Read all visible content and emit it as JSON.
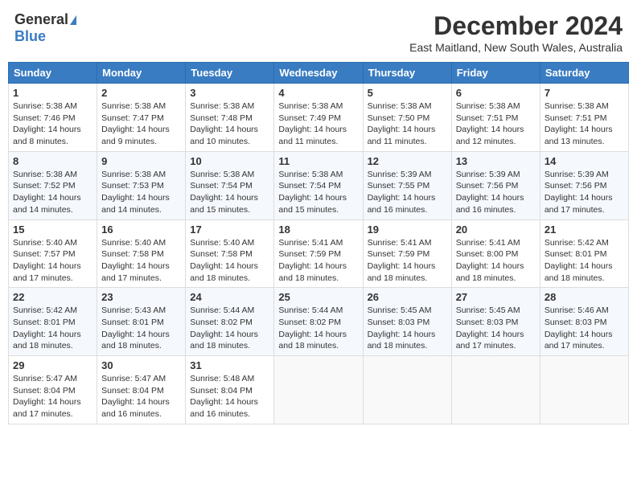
{
  "header": {
    "logo_general": "General",
    "logo_blue": "Blue",
    "month_title": "December 2024",
    "location": "East Maitland, New South Wales, Australia"
  },
  "days_of_week": [
    "Sunday",
    "Monday",
    "Tuesday",
    "Wednesday",
    "Thursday",
    "Friday",
    "Saturday"
  ],
  "weeks": [
    [
      {
        "day": "1",
        "sunrise": "5:38 AM",
        "sunset": "7:46 PM",
        "daylight": "14 hours and 8 minutes."
      },
      {
        "day": "2",
        "sunrise": "5:38 AM",
        "sunset": "7:47 PM",
        "daylight": "14 hours and 9 minutes."
      },
      {
        "day": "3",
        "sunrise": "5:38 AM",
        "sunset": "7:48 PM",
        "daylight": "14 hours and 10 minutes."
      },
      {
        "day": "4",
        "sunrise": "5:38 AM",
        "sunset": "7:49 PM",
        "daylight": "14 hours and 11 minutes."
      },
      {
        "day": "5",
        "sunrise": "5:38 AM",
        "sunset": "7:50 PM",
        "daylight": "14 hours and 11 minutes."
      },
      {
        "day": "6",
        "sunrise": "5:38 AM",
        "sunset": "7:51 PM",
        "daylight": "14 hours and 12 minutes."
      },
      {
        "day": "7",
        "sunrise": "5:38 AM",
        "sunset": "7:51 PM",
        "daylight": "14 hours and 13 minutes."
      }
    ],
    [
      {
        "day": "8",
        "sunrise": "5:38 AM",
        "sunset": "7:52 PM",
        "daylight": "14 hours and 14 minutes."
      },
      {
        "day": "9",
        "sunrise": "5:38 AM",
        "sunset": "7:53 PM",
        "daylight": "14 hours and 14 minutes."
      },
      {
        "day": "10",
        "sunrise": "5:38 AM",
        "sunset": "7:54 PM",
        "daylight": "14 hours and 15 minutes."
      },
      {
        "day": "11",
        "sunrise": "5:38 AM",
        "sunset": "7:54 PM",
        "daylight": "14 hours and 15 minutes."
      },
      {
        "day": "12",
        "sunrise": "5:39 AM",
        "sunset": "7:55 PM",
        "daylight": "14 hours and 16 minutes."
      },
      {
        "day": "13",
        "sunrise": "5:39 AM",
        "sunset": "7:56 PM",
        "daylight": "14 hours and 16 minutes."
      },
      {
        "day": "14",
        "sunrise": "5:39 AM",
        "sunset": "7:56 PM",
        "daylight": "14 hours and 17 minutes."
      }
    ],
    [
      {
        "day": "15",
        "sunrise": "5:40 AM",
        "sunset": "7:57 PM",
        "daylight": "14 hours and 17 minutes."
      },
      {
        "day": "16",
        "sunrise": "5:40 AM",
        "sunset": "7:58 PM",
        "daylight": "14 hours and 17 minutes."
      },
      {
        "day": "17",
        "sunrise": "5:40 AM",
        "sunset": "7:58 PM",
        "daylight": "14 hours and 18 minutes."
      },
      {
        "day": "18",
        "sunrise": "5:41 AM",
        "sunset": "7:59 PM",
        "daylight": "14 hours and 18 minutes."
      },
      {
        "day": "19",
        "sunrise": "5:41 AM",
        "sunset": "7:59 PM",
        "daylight": "14 hours and 18 minutes."
      },
      {
        "day": "20",
        "sunrise": "5:41 AM",
        "sunset": "8:00 PM",
        "daylight": "14 hours and 18 minutes."
      },
      {
        "day": "21",
        "sunrise": "5:42 AM",
        "sunset": "8:01 PM",
        "daylight": "14 hours and 18 minutes."
      }
    ],
    [
      {
        "day": "22",
        "sunrise": "5:42 AM",
        "sunset": "8:01 PM",
        "daylight": "14 hours and 18 minutes."
      },
      {
        "day": "23",
        "sunrise": "5:43 AM",
        "sunset": "8:01 PM",
        "daylight": "14 hours and 18 minutes."
      },
      {
        "day": "24",
        "sunrise": "5:44 AM",
        "sunset": "8:02 PM",
        "daylight": "14 hours and 18 minutes."
      },
      {
        "day": "25",
        "sunrise": "5:44 AM",
        "sunset": "8:02 PM",
        "daylight": "14 hours and 18 minutes."
      },
      {
        "day": "26",
        "sunrise": "5:45 AM",
        "sunset": "8:03 PM",
        "daylight": "14 hours and 18 minutes."
      },
      {
        "day": "27",
        "sunrise": "5:45 AM",
        "sunset": "8:03 PM",
        "daylight": "14 hours and 17 minutes."
      },
      {
        "day": "28",
        "sunrise": "5:46 AM",
        "sunset": "8:03 PM",
        "daylight": "14 hours and 17 minutes."
      }
    ],
    [
      {
        "day": "29",
        "sunrise": "5:47 AM",
        "sunset": "8:04 PM",
        "daylight": "14 hours and 17 minutes."
      },
      {
        "day": "30",
        "sunrise": "5:47 AM",
        "sunset": "8:04 PM",
        "daylight": "14 hours and 16 minutes."
      },
      {
        "day": "31",
        "sunrise": "5:48 AM",
        "sunset": "8:04 PM",
        "daylight": "14 hours and 16 minutes."
      },
      null,
      null,
      null,
      null
    ]
  ],
  "labels": {
    "sunrise": "Sunrise:",
    "sunset": "Sunset:",
    "daylight": "Daylight:"
  }
}
